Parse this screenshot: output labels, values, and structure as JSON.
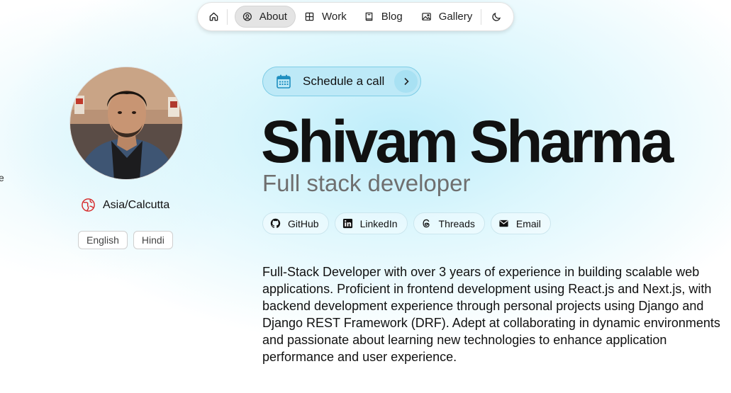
{
  "nav": {
    "home_icon": "home-icon",
    "items": [
      {
        "label": "About",
        "icon": "person-circle-icon",
        "active": true
      },
      {
        "label": "Work",
        "icon": "grid-icon"
      },
      {
        "label": "Blog",
        "icon": "book-icon"
      },
      {
        "label": "Gallery",
        "icon": "image-icon"
      }
    ],
    "theme_icon": "moon-icon"
  },
  "profile": {
    "timezone": "Asia/Calcutta",
    "timezone_icon": "globe-icon",
    "languages": [
      "English",
      "Hindi"
    ],
    "edge_text": "e"
  },
  "hero": {
    "schedule_label": "Schedule a call",
    "schedule_icon": "calendar-icon",
    "name": "Shivam Sharma",
    "role": "Full stack developer",
    "socials": [
      {
        "label": "GitHub",
        "icon": "github-icon"
      },
      {
        "label": "LinkedIn",
        "icon": "linkedin-icon"
      },
      {
        "label": "Threads",
        "icon": "threads-icon"
      },
      {
        "label": "Email",
        "icon": "email-icon"
      }
    ],
    "bio": "Full-Stack Developer with over 3 years of experience in building scalable web applications. Proficient in frontend development using React.js and Next.js, with backend development experience through personal projects using Django and Django REST Framework (DRF). Adept at collaborating in dynamic environments and passionate about learning new technologies to enhance application performance and user experience."
  },
  "colors": {
    "accent_bg": "#bde9f7",
    "accent_border": "#7fcde6",
    "timezone_icon": "#d62828",
    "schedule_icon": "#1f8fc0"
  }
}
